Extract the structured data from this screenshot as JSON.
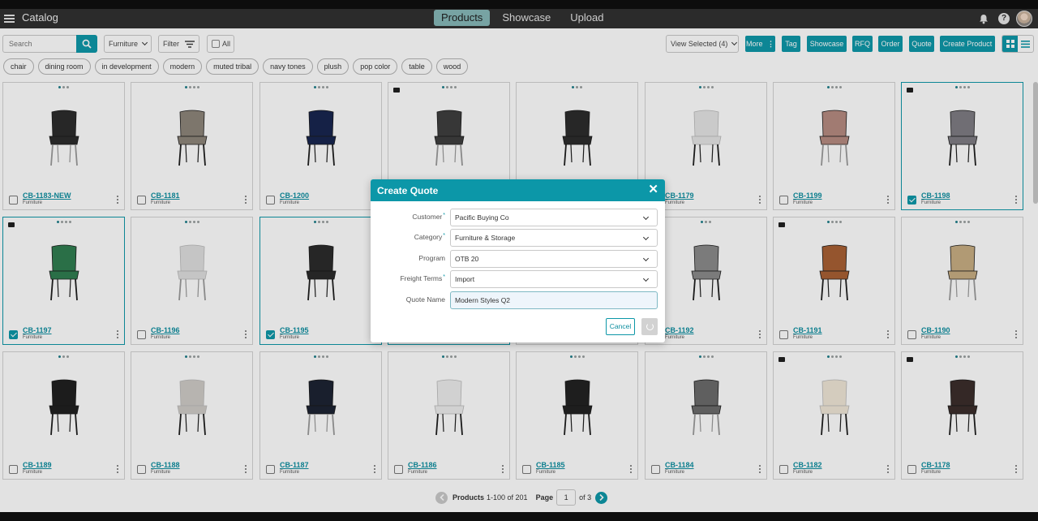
{
  "app": {
    "title": "Catalog"
  },
  "nav": {
    "tabs": [
      "Products",
      "Showcase",
      "Upload"
    ]
  },
  "toolbar": {
    "search_placeholder": "Search",
    "category_filter": "Furniture",
    "filter_label": "Filter",
    "all_label": "All",
    "view_selected": "View Selected (4)",
    "buttons": [
      "More",
      "Tag",
      "Showcase",
      "RFQ",
      "Order",
      "Quote",
      "Create Product"
    ]
  },
  "tags": [
    "chair",
    "dining room",
    "in development",
    "modern",
    "muted tribal",
    "navy tones",
    "plush",
    "pop color",
    "table",
    "wood"
  ],
  "products": [
    {
      "code": "CB-1183-NEW",
      "category": "Furniture",
      "selected": false,
      "cart": false,
      "dots": 3
    },
    {
      "code": "CB-1181",
      "category": "Furniture",
      "selected": false,
      "cart": false,
      "dots": 4
    },
    {
      "code": "CB-1200",
      "category": "Furniture",
      "selected": false,
      "cart": false,
      "dots": 4
    },
    {
      "code": "",
      "category": "",
      "selected": false,
      "cart": true,
      "dots": 4
    },
    {
      "code": "",
      "category": "",
      "selected": false,
      "cart": false,
      "dots": 3
    },
    {
      "code": "CB-1179",
      "category": "Furniture",
      "selected": false,
      "cart": false,
      "dots": 4
    },
    {
      "code": "CB-1199",
      "category": "Furniture",
      "selected": false,
      "cart": false,
      "dots": 4
    },
    {
      "code": "CB-1198",
      "category": "Furniture",
      "selected": true,
      "cart": true,
      "dots": 4
    },
    {
      "code": "CB-1197",
      "category": "Furniture",
      "selected": true,
      "cart": true,
      "dots": 4
    },
    {
      "code": "CB-1196",
      "category": "Furniture",
      "selected": false,
      "cart": false,
      "dots": 4
    },
    {
      "code": "CB-1195",
      "category": "Furniture",
      "selected": true,
      "cart": false,
      "dots": 4
    },
    {
      "code": "",
      "category": "",
      "selected": true,
      "cart": false,
      "dots": 4
    },
    {
      "code": "",
      "category": "",
      "selected": false,
      "cart": false,
      "dots": 4
    },
    {
      "code": "CB-1192",
      "category": "Furniture",
      "selected": false,
      "cart": false,
      "dots": 3
    },
    {
      "code": "CB-1191",
      "category": "Furniture",
      "selected": false,
      "cart": true,
      "dots": 4
    },
    {
      "code": "CB-1190",
      "category": "Furniture",
      "selected": false,
      "cart": false,
      "dots": 4
    },
    {
      "code": "CB-1189",
      "category": "Furniture",
      "selected": false,
      "cart": false,
      "dots": 3
    },
    {
      "code": "CB-1188",
      "category": "Furniture",
      "selected": false,
      "cart": false,
      "dots": 4
    },
    {
      "code": "CB-1187",
      "category": "Furniture",
      "selected": false,
      "cart": false,
      "dots": 4
    },
    {
      "code": "CB-1186",
      "category": "Furniture",
      "selected": false,
      "cart": false,
      "dots": 4
    },
    {
      "code": "CB-1185",
      "category": "Furniture",
      "selected": false,
      "cart": false,
      "dots": 4
    },
    {
      "code": "CB-1184",
      "category": "Furniture",
      "selected": false,
      "cart": false,
      "dots": 4
    },
    {
      "code": "CB-1182",
      "category": "Furniture",
      "selected": false,
      "cart": true,
      "dots": 4
    },
    {
      "code": "CB-1178",
      "category": "Furniture",
      "selected": false,
      "cart": true,
      "dots": 4
    }
  ],
  "chair_colors": [
    "#2b2b2b",
    "#8d8479",
    "#16244e",
    "#3d3d3d",
    "#2b2b2b",
    "#e4e4e4",
    "#b58a80",
    "#7e7c82",
    "#2e7d4f",
    "#dedede",
    "#2a2a2a",
    "#ffffff",
    "#ffffff",
    "#8a8a8a",
    "#a85f33",
    "#c8ad82",
    "#1e1e1e",
    "#cfcbc6",
    "#1b2231",
    "#ececec",
    "#202020",
    "#6a6a6a",
    "#efe6d6",
    "#3a2c2a"
  ],
  "pagination": {
    "label": "Products",
    "range": "1-100 of 201",
    "page_label": "Page",
    "page": "1",
    "of_text": "of 3"
  },
  "modal": {
    "title": "Create Quote",
    "close": "✕",
    "fields": [
      {
        "label": "Customer",
        "required": true,
        "value": "Pacific Buying Co",
        "type": "select"
      },
      {
        "label": "Category",
        "required": true,
        "value": "Furniture & Storage",
        "type": "select"
      },
      {
        "label": "Program",
        "required": false,
        "value": "OTB 20",
        "type": "select"
      },
      {
        "label": "Freight Terms",
        "required": true,
        "value": "Import",
        "type": "select"
      },
      {
        "label": "Quote Name",
        "required": false,
        "value": "Modern Styles Q2",
        "type": "input"
      }
    ],
    "cancel_label": "Cancel"
  }
}
